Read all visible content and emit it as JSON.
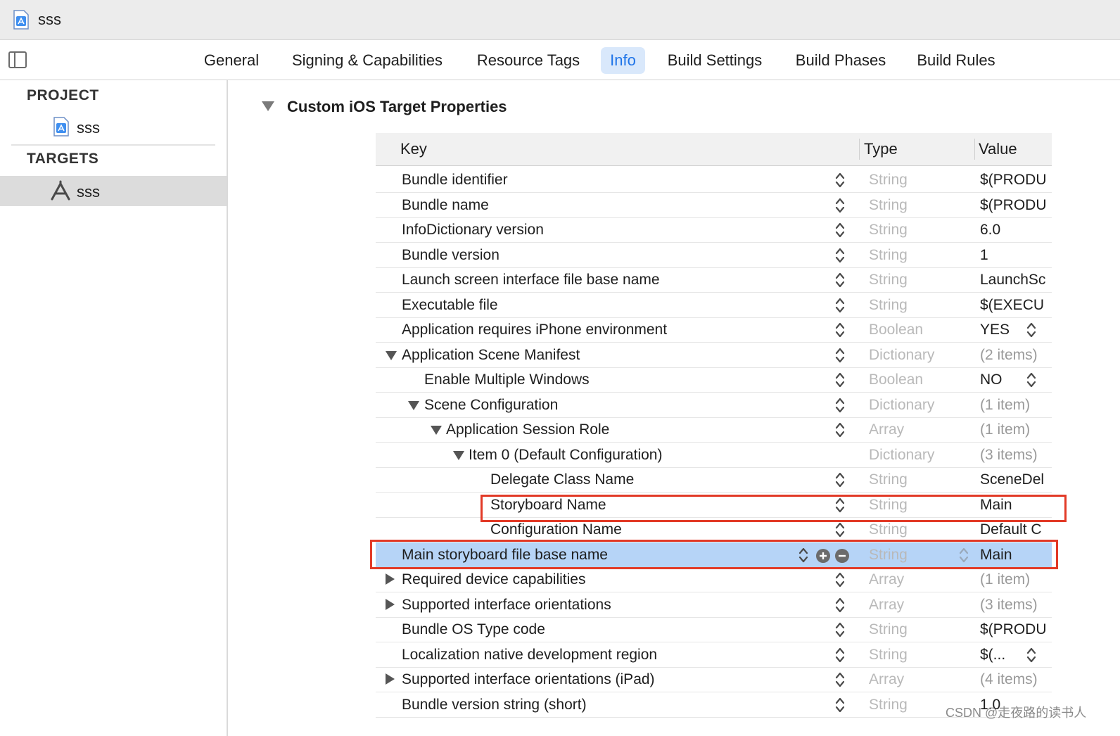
{
  "window": {
    "title": "sss"
  },
  "tabs": [
    {
      "label": "General"
    },
    {
      "label": "Signing & Capabilities"
    },
    {
      "label": "Resource Tags"
    },
    {
      "label": "Info",
      "active": true
    },
    {
      "label": "Build Settings"
    },
    {
      "label": "Build Phases"
    },
    {
      "label": "Build Rules"
    }
  ],
  "sidebar": {
    "project_header": "PROJECT",
    "project_item": "sss",
    "targets_header": "TARGETS",
    "target_item": "sss"
  },
  "section": {
    "title": "Custom iOS Target Properties"
  },
  "table": {
    "headers": {
      "key": "Key",
      "type": "Type",
      "value": "Value"
    },
    "rows": [
      {
        "key": "Bundle identifier",
        "type": "String",
        "value": "$(PRODU",
        "level": 0
      },
      {
        "key": "Bundle name",
        "type": "String",
        "value": "$(PRODU",
        "level": 0
      },
      {
        "key": "InfoDictionary version",
        "type": "String",
        "value": "6.0",
        "level": 0
      },
      {
        "key": "Bundle version",
        "type": "String",
        "value": "1",
        "level": 0
      },
      {
        "key": "Launch screen interface file base name",
        "type": "String",
        "value": "LaunchSc",
        "level": 0
      },
      {
        "key": "Executable file",
        "type": "String",
        "value": "$(EXECU",
        "level": 0
      },
      {
        "key": "Application requires iPhone environment",
        "type": "Boolean",
        "value": "YES",
        "level": 0
      },
      {
        "key": "Application Scene Manifest",
        "type": "Dictionary",
        "value": "(2 items)",
        "level": 0,
        "disclosure": "open"
      },
      {
        "key": "Enable Multiple Windows",
        "type": "Boolean",
        "value": "NO",
        "level": 1
      },
      {
        "key": "Scene Configuration",
        "type": "Dictionary",
        "value": "(1 item)",
        "level": 1,
        "disclosure": "open"
      },
      {
        "key": "Application Session Role",
        "type": "Array",
        "value": "(1 item)",
        "level": 2,
        "disclosure": "open"
      },
      {
        "key": "Item 0 (Default Configuration)",
        "type": "Dictionary",
        "value": "(3 items)",
        "level": 3,
        "disclosure": "open"
      },
      {
        "key": "Delegate Class Name",
        "type": "String",
        "value": "SceneDel",
        "level": 4
      },
      {
        "key": "Storyboard Name",
        "type": "String",
        "value": "Main",
        "level": 4
      },
      {
        "key": "Configuration Name",
        "type": "String",
        "value": "Default C",
        "level": 4
      },
      {
        "key": "Main storyboard file base name",
        "type": "String",
        "value": "Main",
        "level": 0,
        "selected": true
      },
      {
        "key": "Required device capabilities",
        "type": "Array",
        "value": "(1 item)",
        "level": 0,
        "disclosure": "closed"
      },
      {
        "key": "Supported interface orientations",
        "type": "Array",
        "value": "(3 items)",
        "level": 0,
        "disclosure": "closed"
      },
      {
        "key": "Bundle OS Type code",
        "type": "String",
        "value": "$(PRODU",
        "level": 0
      },
      {
        "key": "Localization native development region",
        "type": "String",
        "value": "$(...",
        "level": 0
      },
      {
        "key": "Supported interface orientations (iPad)",
        "type": "Array",
        "value": "(4 items)",
        "level": 0,
        "disclosure": "closed"
      },
      {
        "key": "Bundle version string (short)",
        "type": "String",
        "value": "1.0",
        "level": 0
      }
    ]
  },
  "watermark": "CSDN @走夜路的读书人",
  "colors": {
    "accent": "#1f74e8",
    "selection": "#b6d4f7",
    "highlight": "#e23a27"
  }
}
